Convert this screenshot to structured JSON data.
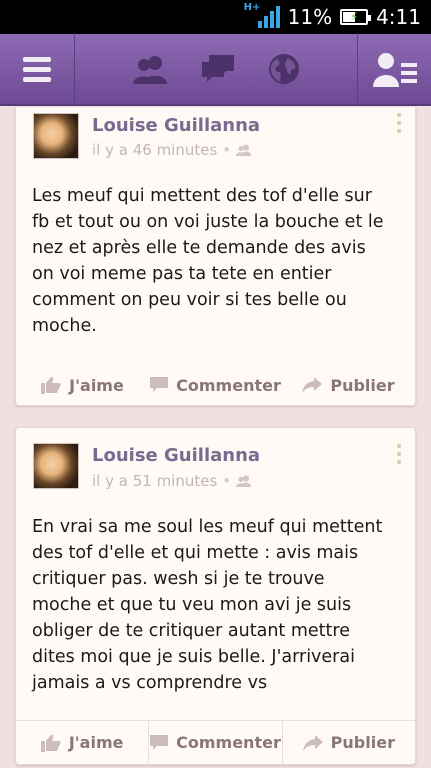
{
  "status_bar": {
    "network": "H+",
    "battery_percent": "11%",
    "time": "4:11"
  },
  "nav": {
    "menu_icon": "menu-icon",
    "icons": [
      "friends-icon",
      "messages-icon",
      "notifications-globe-icon"
    ],
    "right_icon": "friend-list-icon"
  },
  "posts": [
    {
      "author": "Louise Guillanna",
      "time": "il y a 46 minutes",
      "privacy_icon": "friends-icon",
      "text": "Les meuf qui mettent des tof d'elle sur\nfb et tout ou on voi juste la bouche et le\nnez et après elle te demande des avis\non voi meme pas ta tete en entier\ncomment on peu voir si tes belle ou\nmoche."
    },
    {
      "author": "Louise Guillanna",
      "time": "il y a 51 minutes",
      "privacy_icon": "friends-icon",
      "text": "En vrai sa me soul les meuf qui mettent\ndes tof d'elle et qui mette : avis mais\ncritiquer pas. wesh si je te trouve\nmoche et que tu veu mon avi je suis\nobliger de te critiquer autant mettre\ndites moi que je suis belle. J'arriverai\njamais a vs comprendre vs"
    }
  ],
  "actions": {
    "like": "J'aime",
    "comment": "Commenter",
    "share": "Publier"
  },
  "colors": {
    "navbar": "#7b57a2",
    "author": "#7a6a8f",
    "background": "#f0e0e0"
  }
}
